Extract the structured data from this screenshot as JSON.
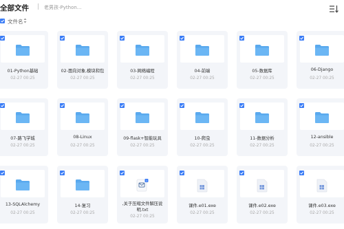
{
  "header": {
    "title": "全部文件",
    "separator": "|",
    "breadcrumb": "老男孩-Python..."
  },
  "toolbar": {
    "sort_label": "文件名",
    "sort_caret": "▲▼"
  },
  "colors": {
    "accent": "#3a7cf6",
    "folder": "#5aa9ee",
    "card_bg": "#f3f5f9"
  },
  "files": [
    {
      "name": "01-Python基础",
      "date": "02-27 00:25",
      "type": "folder"
    },
    {
      "name": "02-面向对象,模块和包",
      "date": "02-27 00:25",
      "type": "folder"
    },
    {
      "name": "03-网络编程",
      "date": "02-27 00:25",
      "type": "folder"
    },
    {
      "name": "04-前端",
      "date": "02-27 00:25",
      "type": "folder"
    },
    {
      "name": "05-数据库",
      "date": "02-27 00:25",
      "type": "folder"
    },
    {
      "name": "06-Django",
      "date": "02-27 00:25",
      "type": "folder"
    },
    {
      "name": "07-路飞学城",
      "date": "02-27 00:25",
      "type": "folder"
    },
    {
      "name": "08-Linux",
      "date": "02-27 00:25",
      "type": "folder"
    },
    {
      "name": "09-flask+智能玩具",
      "date": "02-27 00:25",
      "type": "folder"
    },
    {
      "name": "10-爬虫",
      "date": "02-27 00:25",
      "type": "folder"
    },
    {
      "name": "11-数据分析",
      "date": "02-27 00:25",
      "type": "folder"
    },
    {
      "name": "12-ansible",
      "date": "02-27 00:25",
      "type": "folder"
    },
    {
      "name": "13-SQLAlchemy",
      "date": "02-27 00:25",
      "type": "folder"
    },
    {
      "name": "14-复习",
      "date": "02-27 00:25",
      "type": "folder"
    },
    {
      "name": ",关于压缩文件解压说明.txt",
      "date": "02-27 00:25",
      "type": "txt"
    },
    {
      "name": "课件.e01.exe",
      "date": "02-27 00:25",
      "type": "exe"
    },
    {
      "name": "课件.e02.exe",
      "date": "02-27 00:25",
      "type": "exe"
    },
    {
      "name": "课件.e03.exe",
      "date": "02-27 00:25",
      "type": "exe"
    }
  ]
}
